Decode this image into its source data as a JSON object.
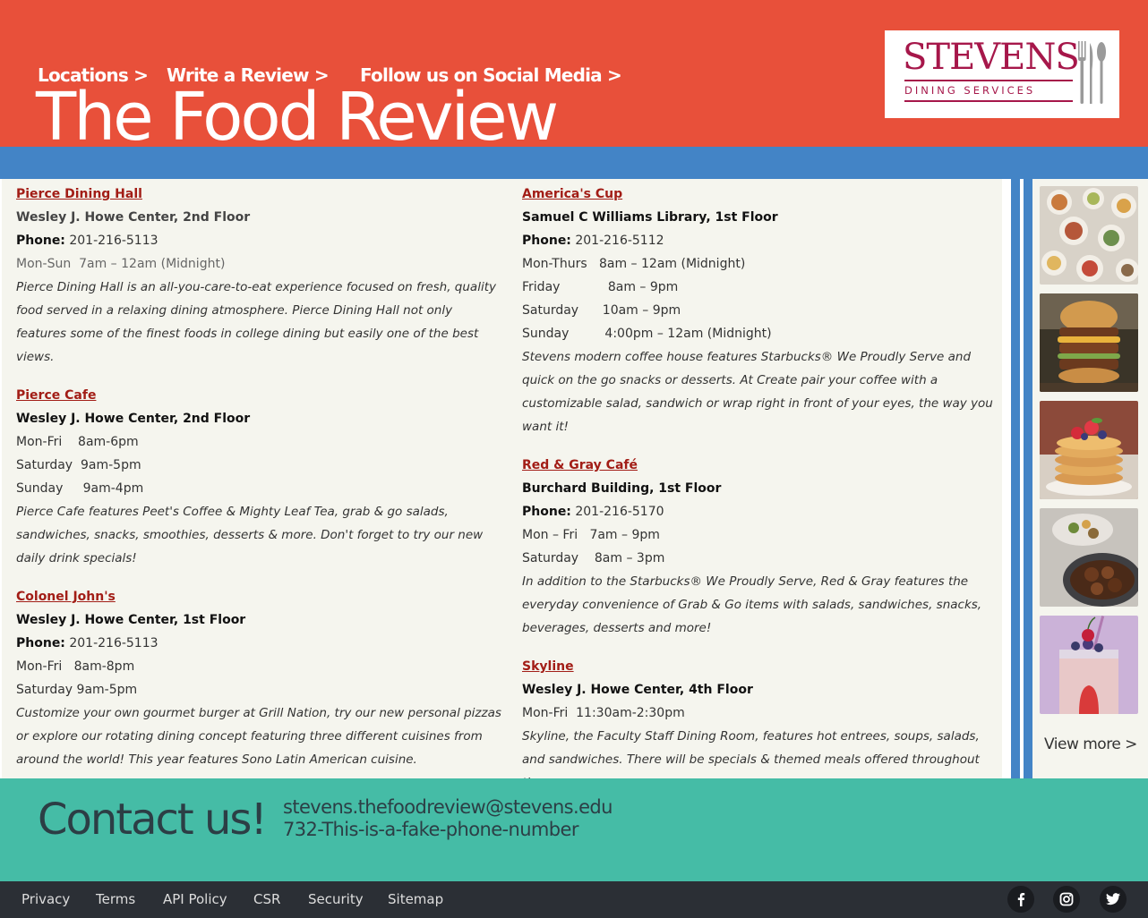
{
  "header": {
    "nav": [
      {
        "label": "Locations >"
      },
      {
        "label": "Write a Review >"
      },
      {
        "label": "Follow us on Social Media >"
      }
    ],
    "title": "The Food Review",
    "logo": {
      "word": "STEVENS",
      "sub": "DINING SERVICES"
    },
    "colors": {
      "header_bg": "#e8503a",
      "band": "#4384c6",
      "logo": "#a6174a"
    }
  },
  "left_column": [
    {
      "name": "Pierce Dining Hall",
      "location": "Wesley J. Howe Center, 2nd Floor",
      "phone_label": "Phone:",
      "phone": " 201-216-5113",
      "hours": [
        "Mon-Sun  7am – 12am (Midnight)"
      ],
      "description": "Pierce Dining Hall is an all-you-care-to-eat experience focused on fresh, quality food served in a relaxing dining atmosphere. Pierce Dining Hall not only features some of the finest foods in college dining but easily one of the best views."
    },
    {
      "name": "Pierce Cafe",
      "location": "Wesley J. Howe Center, 2nd Floor",
      "hours": [
        "Mon-Fri    8am-6pm",
        "Saturday  9am-5pm",
        "Sunday     9am-4pm"
      ],
      "description": "Pierce Cafe features Peet's Coffee & Mighty Leaf Tea, grab & go salads, sandwiches, snacks, smoothies, desserts & more. Don't forget to try our new daily drink specials!"
    },
    {
      "name": "Colonel John's",
      "location": "Wesley J. Howe Center, 1st Floor",
      "phone_label": "Phone:",
      "phone": " 201-216-5113",
      "hours": [
        "Mon-Fri   8am-8pm",
        "Saturday 9am-5pm"
      ],
      "description": "Customize your own gourmet burger at Grill Nation, try our new personal pizzas or explore our rotating dining concept featuring three different cuisines from around the world! This year features Sono Latin American cuisine."
    }
  ],
  "right_column": [
    {
      "name": "America's Cup",
      "location": "Samuel C Williams Library, 1st Floor",
      "phone_label": "Phone:",
      "phone": " 201-216-5112",
      "hours": [
        "Mon-Thurs   8am – 12am (Midnight)",
        "Friday            8am – 9pm",
        "Saturday      10am – 9pm",
        "Sunday         4:00pm – 12am (Midnight)"
      ],
      "description": "Stevens modern coffee house features Starbucks® We Proudly Serve and quick on the go snacks or desserts.  At Create pair your coffee with a customizable salad, sandwich or wrap right in front of your eyes, the way you want it!"
    },
    {
      "name": "Red & Gray Café",
      "location": "Burchard Building, 1st Floor",
      "phone_label": "Phone:",
      "phone": " 201-216-5170",
      "hours": [
        "Mon – Fri   7am – 9pm",
        "Saturday    8am – 3pm"
      ],
      "description": "In addition to the Starbucks® We Proudly Serve, Red & Gray features the everyday convenience of Grab & Go items with salads, sandwiches, snacks, beverages, desserts and more!"
    },
    {
      "name": "Skyline ",
      "location": "Wesley J. Howe Center, 4th Floor",
      "hours": [
        "Mon-Fri  11:30am-2:30pm"
      ],
      "description": "Skyline, the Faculty Staff Dining Room, features hot entrees, soups, salads, and sandwiches. There will be specials & themed meals offered throughout the year."
    }
  ],
  "sidebar": {
    "images": [
      "food-platter-image",
      "burger-image",
      "pancakes-image",
      "beef-dish-image",
      "smoothie-image"
    ],
    "view_more": "View more >"
  },
  "contact": {
    "title": "Contact us!",
    "email": "stevens.thefoodreview@stevens.edu",
    "phone": "732-This-is-a-fake-phone-number",
    "bg": "#45bca6"
  },
  "footer": {
    "links": [
      "Privacy",
      "Terms",
      "API Policy",
      "CSR",
      "Security",
      "Sitemap"
    ],
    "social": [
      "facebook-icon",
      "instagram-icon",
      "twitter-icon"
    ]
  }
}
